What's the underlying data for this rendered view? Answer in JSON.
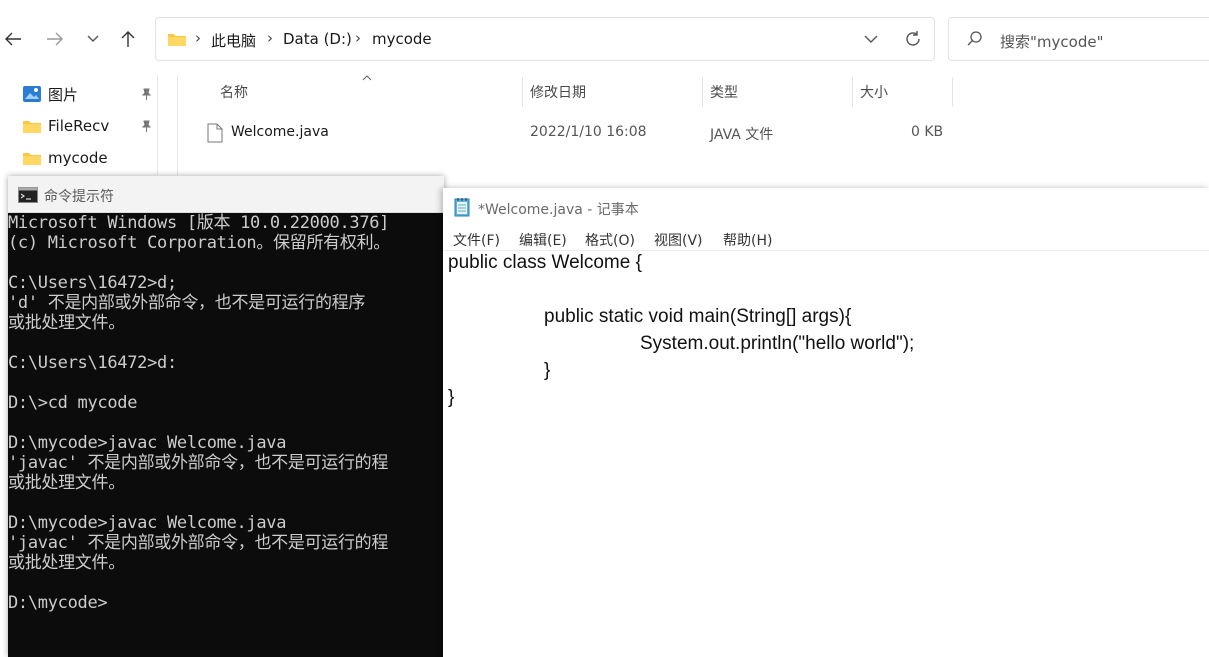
{
  "explorer": {
    "breadcrumb": [
      "此电脑",
      "Data (D:)",
      "mycode"
    ],
    "search_placeholder": "搜索\"mycode\"",
    "sidebar": [
      {
        "label": "图片",
        "icon": "pictures-icon",
        "pinned": true
      },
      {
        "label": "FileRecv",
        "icon": "folder-icon",
        "pinned": true
      },
      {
        "label": "mycode",
        "icon": "folder-icon",
        "pinned": false
      }
    ],
    "columns": {
      "name": "名称",
      "modified": "修改日期",
      "type": "类型",
      "size": "大小"
    },
    "files": [
      {
        "name": "Welcome.java",
        "modified": "2022/1/10 16:08",
        "type": "JAVA 文件",
        "size": "0 KB"
      }
    ]
  },
  "cmd": {
    "title": "命令提示符",
    "lines": [
      "Microsoft Windows [版本 10.0.22000.376]",
      "(c) Microsoft Corporation。保留所有权利。",
      "",
      "C:\\Users\\16472>d;",
      "'d' 不是内部或外部命令，也不是可运行的程序",
      "或批处理文件。",
      "",
      "C:\\Users\\16472>d:",
      "",
      "D:\\>cd mycode",
      "",
      "D:\\mycode>javac Welcome.java",
      "'javac' 不是内部或外部命令，也不是可运行的程",
      "或批处理文件。",
      "",
      "D:\\mycode>javac Welcome.java",
      "'javac' 不是内部或外部命令，也不是可运行的程",
      "或批处理文件。",
      "",
      "D:\\mycode>"
    ]
  },
  "notepad": {
    "title": "*Welcome.java - 记事本",
    "menu": [
      "文件(F)",
      "编辑(E)",
      "格式(O)",
      "视图(V)",
      "帮助(H)"
    ],
    "code": [
      {
        "text": "public class Welcome {",
        "indent": 0
      },
      {
        "text": "",
        "indent": 0
      },
      {
        "text": "public static void main(String[] args){",
        "indent": 1
      },
      {
        "text": "System.out.println(\"hello world\");",
        "indent": 2
      },
      {
        "text": "}",
        "indent": 1
      },
      {
        "text": "}",
        "indent": 0
      }
    ]
  }
}
